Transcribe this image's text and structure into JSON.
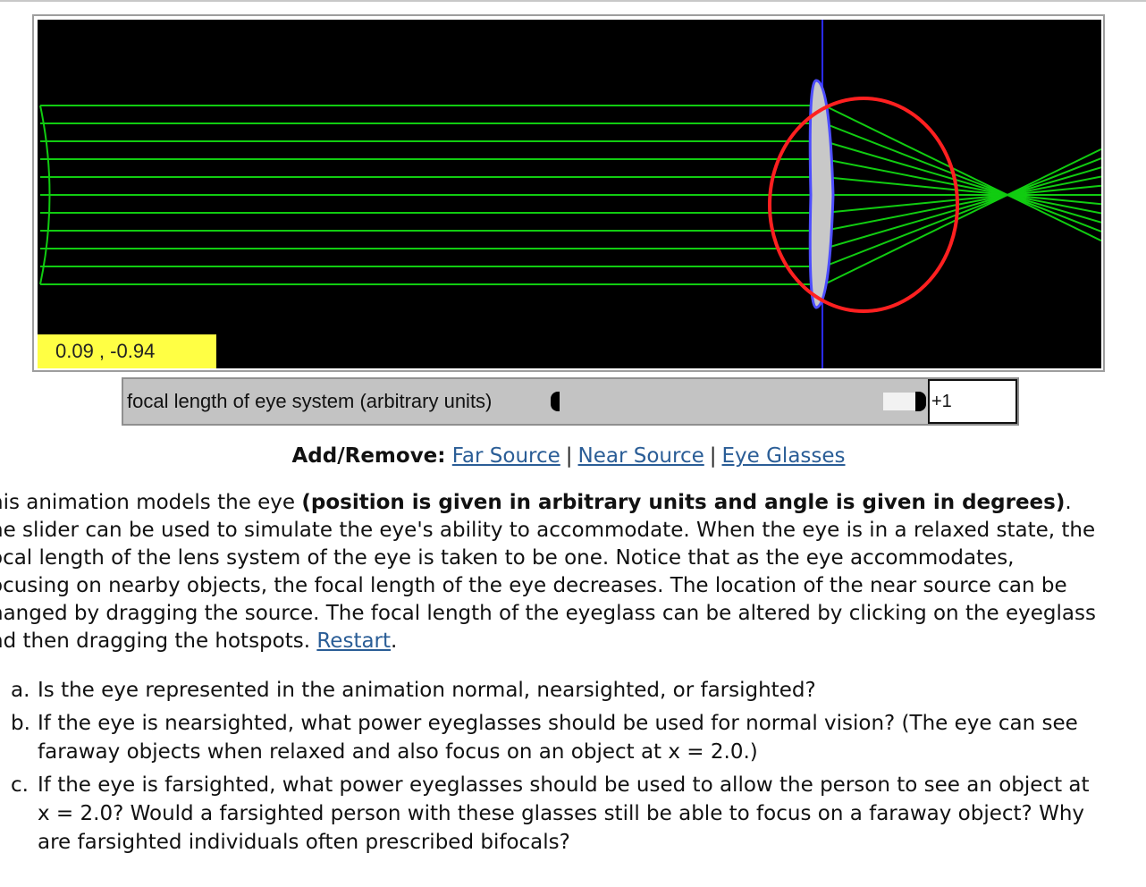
{
  "simulation": {
    "coord_readout": "0.09 , -0.94",
    "colors": {
      "background": "#000000",
      "rays": "#11cc11",
      "lens": "#c8c8c8",
      "eye": "#ff2020",
      "axis": "#2a2aff",
      "readout_bg": "#ffff44"
    }
  },
  "slider": {
    "label": "focal length of eye system (arbitrary units)",
    "value": "+1"
  },
  "add_remove": {
    "label": "Add/Remove:",
    "links": [
      "Far Source",
      "Near Source",
      "Eye Glasses"
    ],
    "separator": "|"
  },
  "description": {
    "prefix": "his animation models the eye ",
    "bold": "(position is given in arbitrary units and angle is given in degrees)",
    "suffix": ".",
    "lines": [
      "he slider can be used to simulate the eye's ability to accommodate. When the eye is in a relaxed state, the",
      "ocal length of the lens system of the eye is taken to be one. Notice that as the eye accommodates,",
      "ocusing on nearby objects, the focal length of the eye decreases. The location of the near source can be",
      "hanged by dragging the source. The focal length of the eyeglass can be altered by clicking on the eyeglass"
    ],
    "last_line": "nd then dragging the hotspots. ",
    "restart_link": "Restart",
    "end": "."
  },
  "questions": [
    {
      "letter": "a.",
      "lines": [
        "Is the eye represented in the animation normal, nearsighted, or farsighted?"
      ]
    },
    {
      "letter": "b.",
      "lines": [
        "If the eye is nearsighted, what power eyeglasses should be used for normal vision? (The eye can see",
        "faraway objects when relaxed and also focus on an object at x = 2.0.)"
      ]
    },
    {
      "letter": "c.",
      "lines": [
        "If the eye is farsighted, what power eyeglasses should be used to allow the person to see an object at",
        "x = 2.0? Would a farsighted person with these glasses still be able to focus on a faraway object? Why",
        "are farsighted individuals often prescribed bifocals?"
      ]
    }
  ]
}
